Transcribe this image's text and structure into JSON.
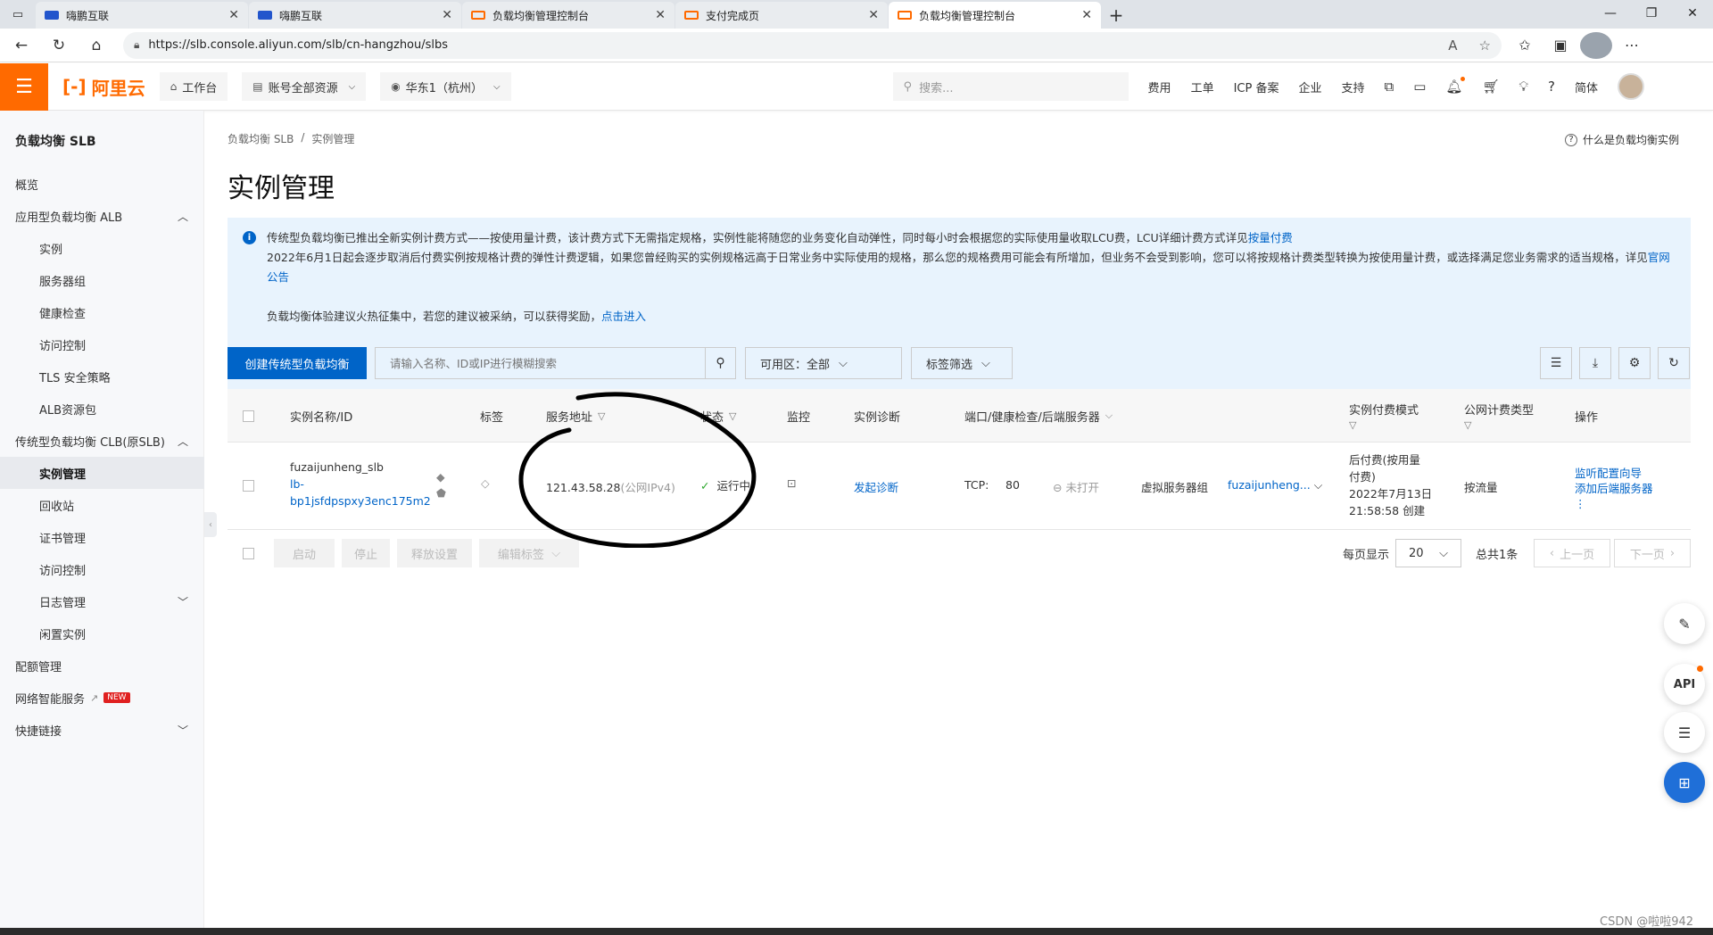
{
  "browser": {
    "tabs": [
      {
        "label": "嗨鹏互联",
        "icon": "blue"
      },
      {
        "label": "嗨鹏互联",
        "icon": "blue"
      },
      {
        "label": "负载均衡管理控制台",
        "icon": "orange"
      },
      {
        "label": "支付完成页",
        "icon": "orange"
      },
      {
        "label": "负载均衡管理控制台",
        "icon": "orange"
      }
    ],
    "url": "https://slb.console.aliyun.com/slb/cn-hangzhou/slbs"
  },
  "header": {
    "logo": "阿里云",
    "workbench": "工作台",
    "account": "账号全部资源",
    "region": "华东1（杭州）",
    "search_placeholder": "搜索...",
    "links": [
      "费用",
      "工单",
      "ICP 备案",
      "企业",
      "支持"
    ],
    "lang": "简体"
  },
  "sidebar": {
    "title": "负载均衡 SLB",
    "items": [
      {
        "label": "概览"
      },
      {
        "label": "应用型负载均衡 ALB"
      },
      {
        "label": "实例"
      },
      {
        "label": "服务器组"
      },
      {
        "label": "健康检查"
      },
      {
        "label": "访问控制"
      },
      {
        "label": "TLS 安全策略"
      },
      {
        "label": "ALB资源包"
      },
      {
        "label": "传统型负载均衡 CLB(原SLB)"
      },
      {
        "label": "实例管理"
      },
      {
        "label": "回收站"
      },
      {
        "label": "证书管理"
      },
      {
        "label": "访问控制"
      },
      {
        "label": "日志管理"
      },
      {
        "label": "闲置实例"
      },
      {
        "label": "配额管理"
      },
      {
        "label": "网络智能服务"
      },
      {
        "label": "快捷链接"
      }
    ],
    "new_badge": "NEW"
  },
  "main": {
    "breadcrumb": [
      "负载均衡 SLB",
      "/",
      "实例管理"
    ],
    "help_link": "什么是负载均衡实例",
    "title": "实例管理",
    "notice": {
      "line1": "传统型负载均衡已推出全新实例计费方式——按使用量计费，该计费方式下无需指定规格，实例性能将随您的业务变化自动弹性，同时每小时会根据您的实际使用量收取LCU费，LCU详细计费方式详见",
      "line1_link": "按量付费",
      "line2": "2022年6月1日起会逐步取消后付费实例按规格计费的弹性计费逻辑，如果您曾经购买的实例规格远高于日常业务中实际使用的规格，那么您的规格费用可能会有所增加，但业务不会受到影响，您可以将按规格计费类型转换为按使用量计费，或选择满足您业务需求的适当规格，详见",
      "line2_link": "官网公告",
      "line3": "负载均衡体验建议火热征集中，若您的建议被采纳，可以获得奖励，",
      "line3_link": "点击进入"
    },
    "toolbar": {
      "create": "创建传统型负载均衡",
      "search_placeholder": "请输入名称、ID或IP进行模糊搜索",
      "zone": "可用区：全部",
      "tag_filter": "标签筛选"
    },
    "table": {
      "headers": [
        "实例名称/ID",
        "标签",
        "服务地址",
        "状态",
        "监控",
        "实例诊断",
        "端口/健康检查/后端服务器",
        "实例付费模式",
        "公网计费类型",
        "操作"
      ],
      "row": {
        "name": "fuzaijunheng_slb",
        "id_line1": "lb-",
        "id_line2": "bp1jsfdpspxy3enc175m2",
        "address": "121.43.58.28",
        "address_type": "(公网IPv4)",
        "status": "运行中",
        "diagnose": "发起诊断",
        "protocol": "TCP:",
        "port": "80",
        "health": "未打开",
        "backend_type": "虚拟服务器组",
        "backend_name": "fuzaijunheng...",
        "pay_line1": "后付费(按用量",
        "pay_line2": "付费)",
        "pay_line3": "2022年7月13日",
        "pay_line4": "21:58:58 创建",
        "net_billing": "按流量",
        "op1": "监听配置向导",
        "op2": "添加后端服务器"
      }
    },
    "footer": {
      "actions": [
        "启动",
        "停止",
        "释放设置",
        "编辑标签"
      ],
      "per_page_label": "每页显示",
      "per_page": "20",
      "total": "总共1条",
      "prev": "上一页",
      "next": "下一页"
    }
  },
  "watermark": "CSDN @啦啦942",
  "colors": {
    "brand": "#ff6a00",
    "primary": "#0064c8",
    "notice_bg": "#e8f3fd"
  }
}
